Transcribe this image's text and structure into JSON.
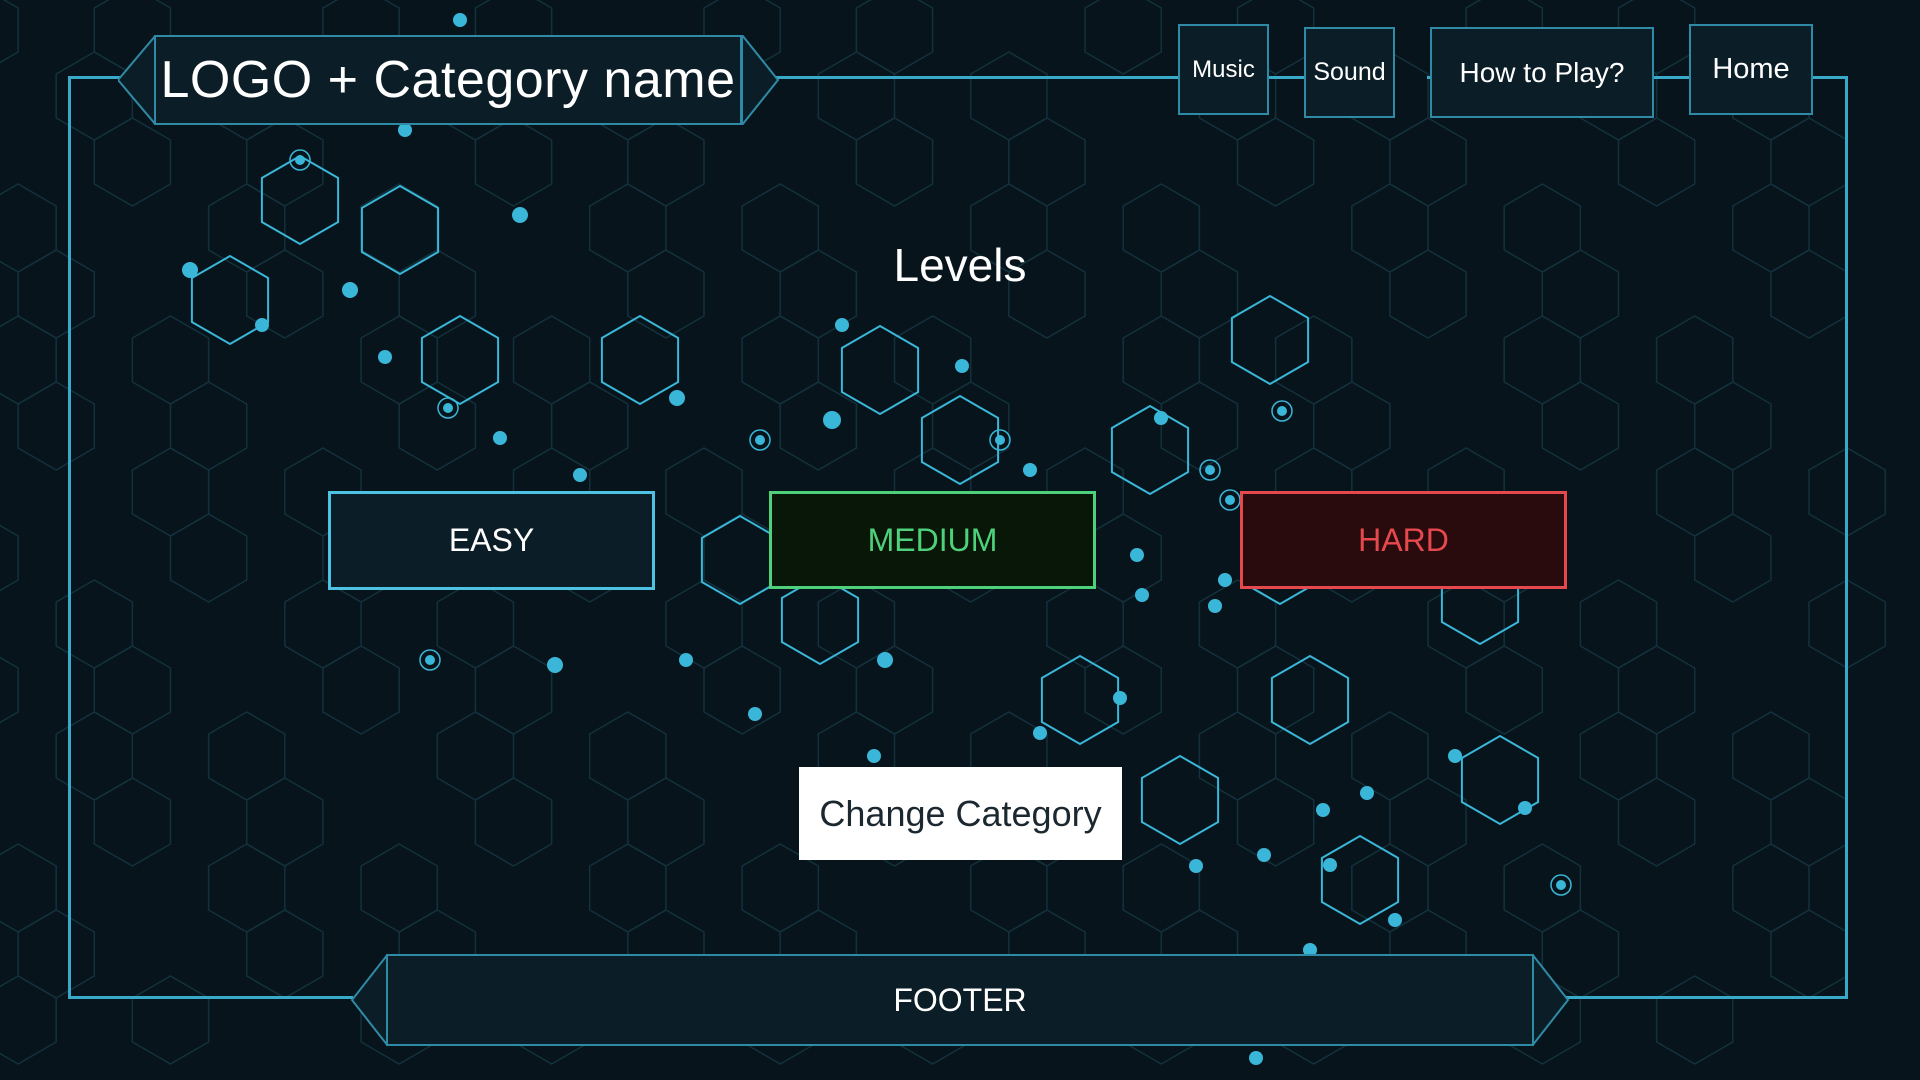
{
  "header": {
    "title": "LOGO + Category name"
  },
  "nav": [
    {
      "label": "Music"
    },
    {
      "label": "Sound"
    },
    {
      "label": "How to Play?"
    },
    {
      "label": "Home"
    }
  ],
  "main": {
    "heading": "Levels",
    "levels": [
      {
        "label": "EASY",
        "color": "#4ec2e2",
        "bg": "#0b1d26"
      },
      {
        "label": "MEDIUM",
        "color": "#4fd17c",
        "bg": "#081708"
      },
      {
        "label": "HARD",
        "color": "#e5484d",
        "bg": "#2a0b0d"
      }
    ],
    "change_category": "Change Category"
  },
  "footer": {
    "label": "FOOTER"
  },
  "colors": {
    "accent": "#39a9c9",
    "background": "#08141b",
    "panel": "#0b1d26"
  }
}
